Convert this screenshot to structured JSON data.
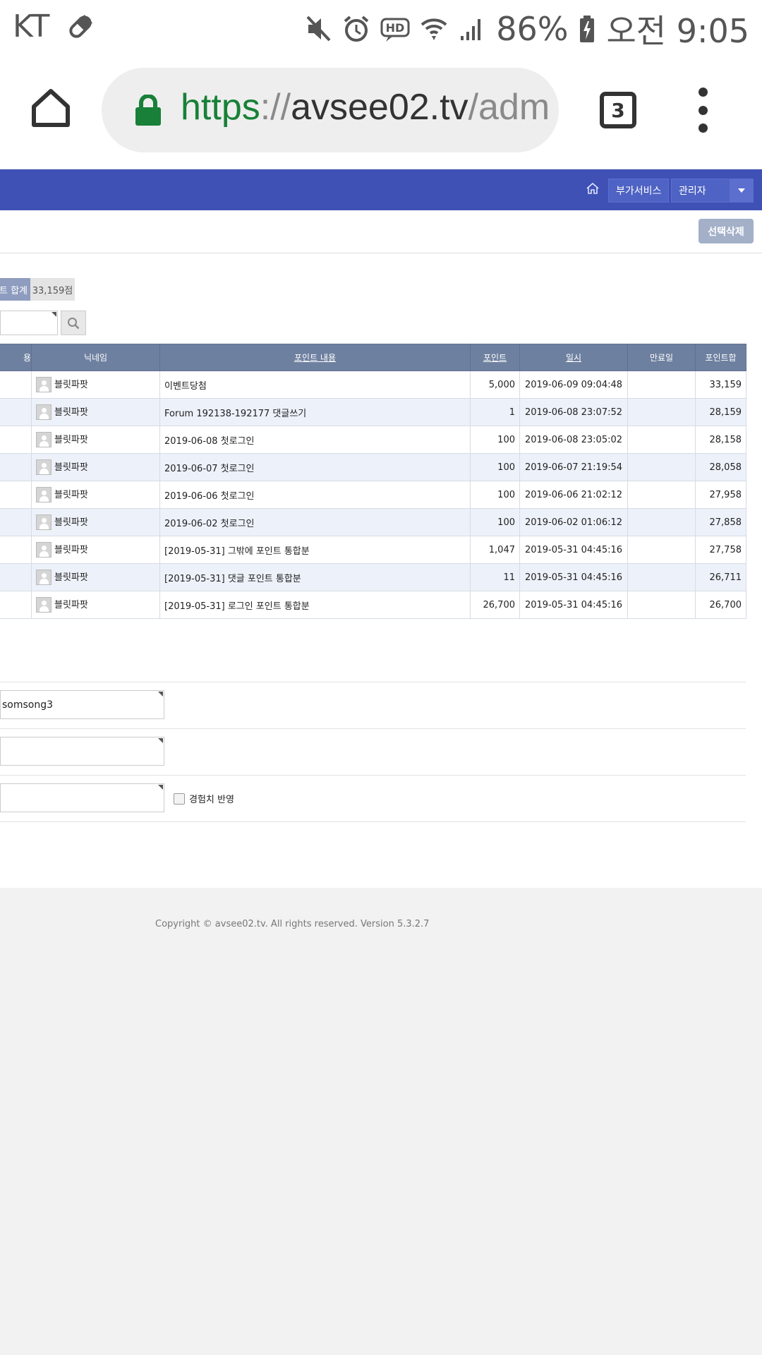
{
  "status_bar": {
    "carrier": "KT",
    "battery": "86%",
    "time": "오전 9:05",
    "icons": [
      "pill-icon",
      "mute-icon",
      "alarm-icon",
      "hd-icon",
      "wifi-icon",
      "signal-icon",
      "battery-charging-icon"
    ]
  },
  "browser": {
    "url_scheme": "https",
    "url_sep": "://",
    "url_host": "avsee02.tv",
    "url_path": "/adm",
    "tab_count": "3"
  },
  "admin_nav": {
    "extra_services": "부가서비스",
    "admin": "관리자"
  },
  "actions": {
    "delete_selected": "선택삭제"
  },
  "summary": {
    "label": "트 합계",
    "value": "33,159점"
  },
  "table": {
    "headers": {
      "col0": "용",
      "nickname": "닉네임",
      "content": "포인트 내용",
      "point": "포인트",
      "datetime": "일시",
      "expiry": "만료일",
      "total": "포인트합"
    },
    "rows": [
      {
        "nickname": "블릿파팟",
        "content": "이벤트당첨",
        "point": "5,000",
        "datetime": "2019-06-09 09:04:48",
        "expiry": "",
        "total": "33,159"
      },
      {
        "nickname": "블릿파팟",
        "content": "Forum 192138-192177 댓글쓰기",
        "point": "1",
        "datetime": "2019-06-08 23:07:52",
        "expiry": "",
        "total": "28,159"
      },
      {
        "nickname": "블릿파팟",
        "content": "2019-06-08 첫로그인",
        "point": "100",
        "datetime": "2019-06-08 23:05:02",
        "expiry": "",
        "total": "28,158"
      },
      {
        "nickname": "블릿파팟",
        "content": "2019-06-07 첫로그인",
        "point": "100",
        "datetime": "2019-06-07 21:19:54",
        "expiry": "",
        "total": "28,058"
      },
      {
        "nickname": "블릿파팟",
        "content": "2019-06-06 첫로그인",
        "point": "100",
        "datetime": "2019-06-06 21:02:12",
        "expiry": "",
        "total": "27,958"
      },
      {
        "nickname": "블릿파팟",
        "content": "2019-06-02 첫로그인",
        "point": "100",
        "datetime": "2019-06-02 01:06:12",
        "expiry": "",
        "total": "27,858"
      },
      {
        "nickname": "블릿파팟",
        "content": "[2019-05-31] 그밖에 포인트 통합분",
        "point": "1,047",
        "datetime": "2019-05-31 04:45:16",
        "expiry": "",
        "total": "27,758"
      },
      {
        "nickname": "블릿파팟",
        "content": "[2019-05-31] 댓글 포인트 통합분",
        "point": "11",
        "datetime": "2019-05-31 04:45:16",
        "expiry": "",
        "total": "26,711"
      },
      {
        "nickname": "블릿파팟",
        "content": "[2019-05-31] 로그인 포인트 통합분",
        "point": "26,700",
        "datetime": "2019-05-31 04:45:16",
        "expiry": "",
        "total": "26,700"
      }
    ]
  },
  "form": {
    "member_id_value": "somsong3",
    "reflect_exp_label": "경험치 반영"
  },
  "footer": {
    "copyright": "Copyright © avsee02.tv. All rights reserved. Version 5.3.2.7"
  }
}
